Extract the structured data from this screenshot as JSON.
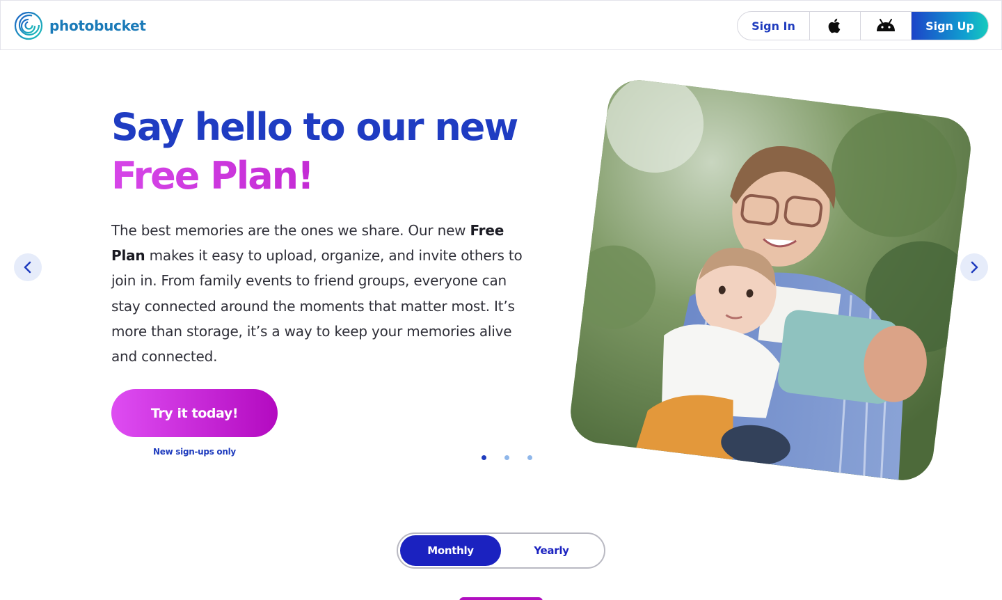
{
  "header": {
    "logo_text": "photobucket",
    "nav": {
      "sign_in": "Sign In",
      "apple_icon": "apple-icon",
      "android_icon": "android-icon",
      "sign_up": "Sign Up"
    }
  },
  "hero": {
    "title_line1": "Say hello to our new",
    "title_line2": "Free Plan!",
    "body_intro": "The best memories are the ones we share. Our new",
    "body_bold": "Free Plan",
    "body_rest": "makes it easy to upload, organize, and invite others to join in. From family events to friend groups, everyone can stay connected around the moments that matter most. It’s more than storage, it’s a way to keep your memories alive and connected.",
    "cta_label": "Try it today!",
    "cta_note": "New sign-ups only",
    "carousel": {
      "slide_count": 3,
      "active_slide": 1
    }
  },
  "pricing": {
    "toggle": {
      "monthly": "Monthly",
      "yearly": "Yearly",
      "selected": "Monthly"
    }
  },
  "colors": {
    "brand_blue": "#1f3cc2",
    "brand_magenta": "#b10fc0",
    "toggle_blue": "#1b22c0",
    "logo_teal": "#1a7ab8"
  }
}
